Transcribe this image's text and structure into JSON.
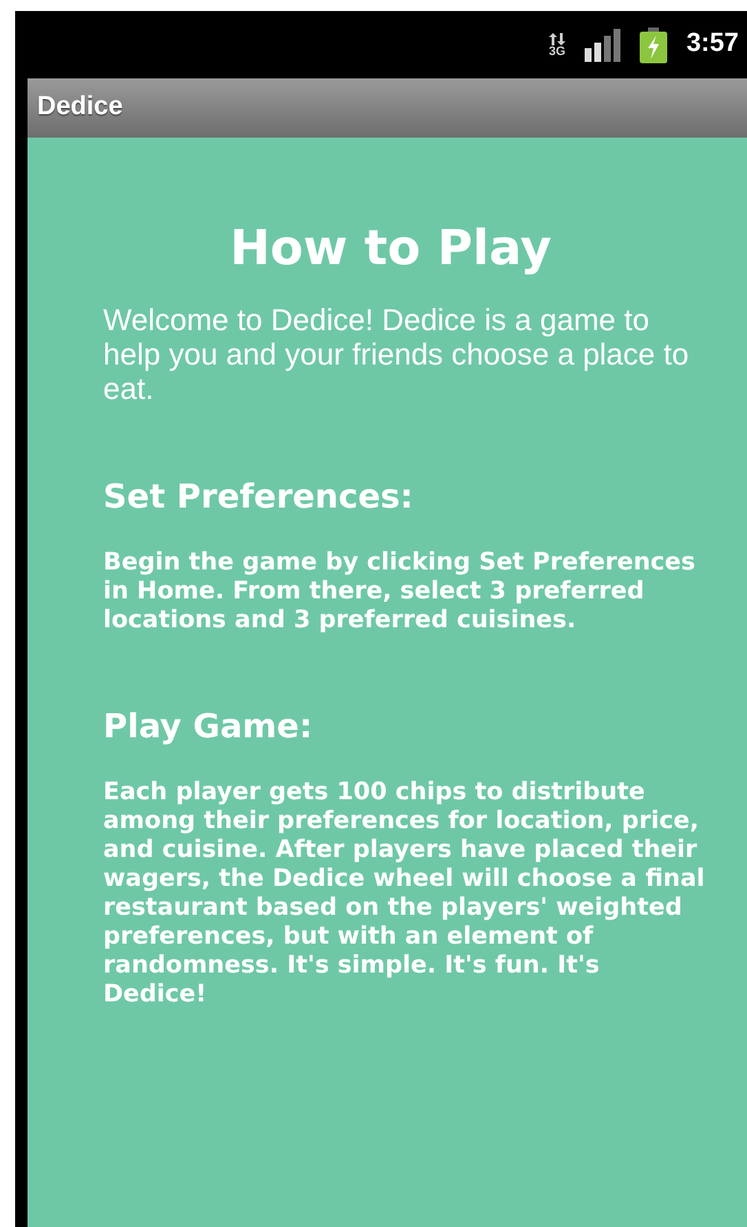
{
  "status_bar": {
    "network_type": "3G",
    "time": "3:57"
  },
  "action_bar": {
    "title": "Dedice"
  },
  "content": {
    "title": "How to Play",
    "intro": "Welcome to Dedice! Dedice is a game to help you and your friends choose a place to eat.",
    "sections": [
      {
        "heading": "Set Preferences:",
        "body": "Begin the game by clicking Set Preferences in Home. From there, select 3 preferred locations and 3 preferred cuisines."
      },
      {
        "heading": "Play Game:",
        "body": "Each player gets 100 chips to distribute among their preferences for location, price, and cuisine. After players have placed their wagers, the Dedice wheel will choose a final restaurant based on the players' weighted preferences, but with an element of randomness. It's simple. It's fun. It's Dedice!"
      }
    ]
  }
}
